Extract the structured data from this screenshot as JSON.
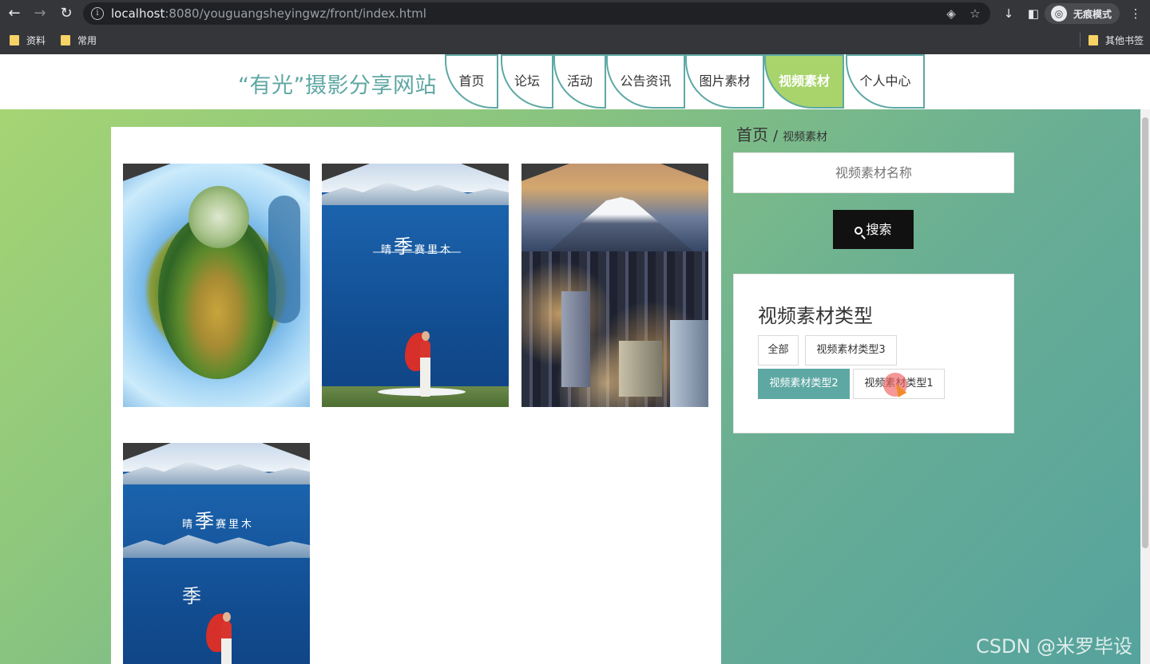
{
  "browser": {
    "url_host": "localhost",
    "url_rest": ":8080/youguangsheyingwz/front/index.html",
    "incognito_label": "无痕模式",
    "bookmarks": [
      "资料",
      "常用"
    ],
    "other_bookmarks": "其他书签"
  },
  "site": {
    "logo": "“有光”摄影分享网站",
    "nav": [
      {
        "label": "首页"
      },
      {
        "label": "论坛"
      },
      {
        "label": "活动"
      },
      {
        "label": "公告资讯"
      },
      {
        "label": "图片素材"
      },
      {
        "label": "视频素材",
        "active": true
      },
      {
        "label": "个人中心"
      }
    ]
  },
  "breadcrumb": {
    "home": "首页",
    "separator": "/",
    "current": "视频素材"
  },
  "search": {
    "placeholder": "视频素材名称",
    "button": "搜索"
  },
  "types": {
    "title": "视频素材类型",
    "items": [
      {
        "label": "全部"
      },
      {
        "label": "视频素材类型3"
      },
      {
        "label": "视频素材类型2",
        "active": true
      },
      {
        "label": "视频素材类型1"
      }
    ]
  },
  "grid": {
    "items": [
      {
        "thumb": "tiny-planet-landscape"
      },
      {
        "thumb": "lake-with-girl",
        "brand": "季",
        "brand_prefix": "晴",
        "brand_suffix": "赛里木"
      },
      {
        "thumb": "fuji-city-night"
      },
      {
        "thumb": "lake-with-girl",
        "brand": "季",
        "brand_prefix": "晴",
        "brand_suffix": "赛里木"
      }
    ]
  },
  "watermark": "CSDN @米罗毕设"
}
